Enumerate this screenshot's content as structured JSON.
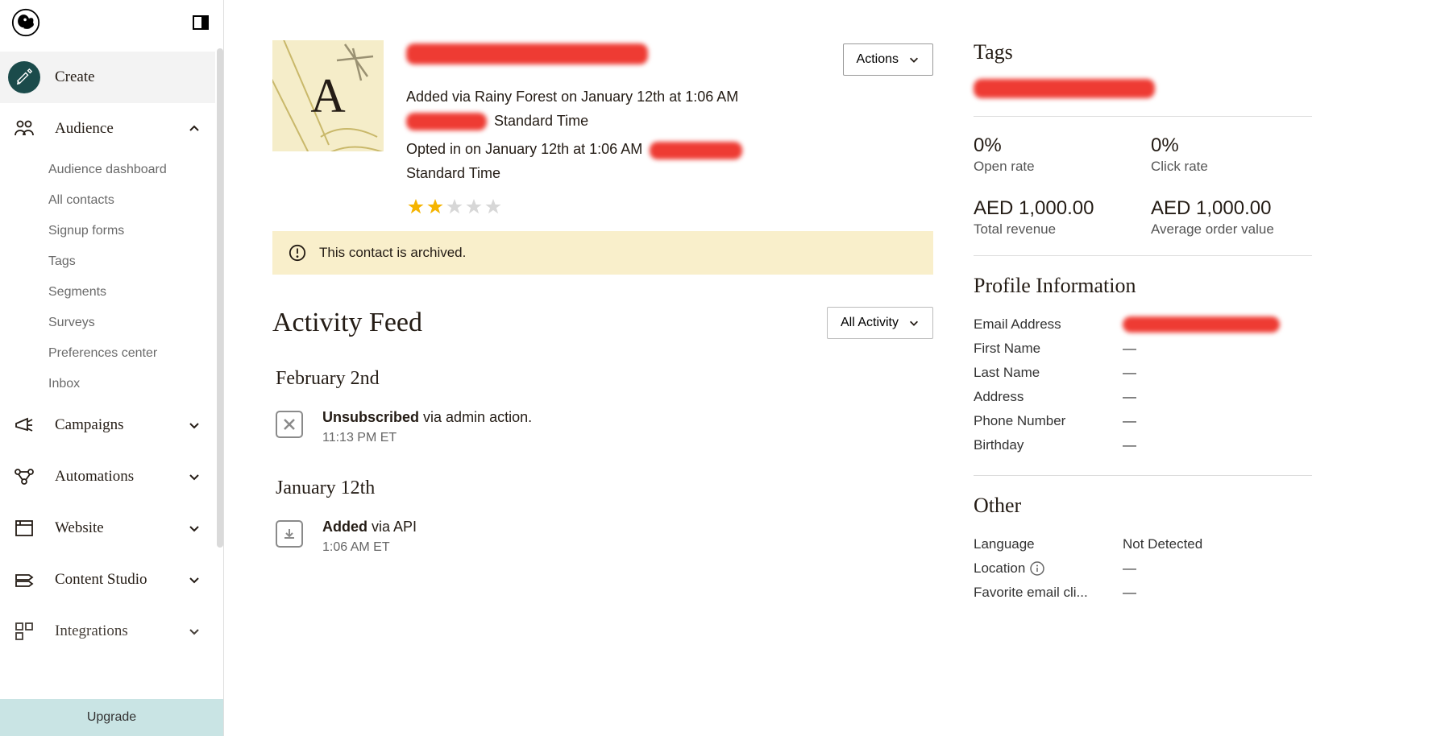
{
  "sidebar": {
    "create_label": "Create",
    "nav": [
      {
        "label": "Audience",
        "expanded": true,
        "sub": [
          "Audience dashboard",
          "All contacts",
          "Signup forms",
          "Tags",
          "Segments",
          "Surveys",
          "Preferences center",
          "Inbox"
        ]
      },
      {
        "label": "Campaigns",
        "expanded": false
      },
      {
        "label": "Automations",
        "expanded": false
      },
      {
        "label": "Website",
        "expanded": false
      },
      {
        "label": "Content Studio",
        "expanded": false
      },
      {
        "label": "Integrations",
        "expanded": false
      }
    ],
    "upgrade_label": "Upgrade"
  },
  "profile": {
    "avatar_letter": "A",
    "actions_label": "Actions",
    "added_prefix": "Added via Rainy Forest on January 12th at 1:06 AM",
    "added_suffix": "Standard Time",
    "opted_prefix": "Opted in on January 12th at 1:06 AM",
    "opted_suffix": "Standard Time",
    "rating": 2,
    "rating_max": 5,
    "archive_message": "This contact is archived."
  },
  "activity": {
    "heading": "Activity Feed",
    "filter_label": "All Activity",
    "groups": [
      {
        "date": "February 2nd",
        "items": [
          {
            "icon": "x",
            "title_bold": "Unsubscribed",
            "title_rest": " via admin action.",
            "time": "11:13 PM ET"
          }
        ]
      },
      {
        "date": "January 12th",
        "items": [
          {
            "icon": "download",
            "title_bold": "Added",
            "title_rest": " via API",
            "time": "1:06 AM ET"
          }
        ]
      }
    ]
  },
  "tags": {
    "heading": "Tags"
  },
  "stats": {
    "open_rate": {
      "value": "0%",
      "label": "Open rate"
    },
    "click_rate": {
      "value": "0%",
      "label": "Click rate"
    },
    "total_revenue": {
      "value": "AED 1,000.00",
      "label": "Total revenue"
    },
    "avg_order": {
      "value": "AED 1,000.00",
      "label": "Average order value"
    }
  },
  "profile_info": {
    "heading": "Profile Information",
    "rows": [
      {
        "label": "Email Address",
        "value": "[redacted]"
      },
      {
        "label": "First Name",
        "value": "—"
      },
      {
        "label": "Last Name",
        "value": "—"
      },
      {
        "label": "Address",
        "value": "—"
      },
      {
        "label": "Phone Number",
        "value": "—"
      },
      {
        "label": "Birthday",
        "value": "—"
      }
    ]
  },
  "other": {
    "heading": "Other",
    "rows": [
      {
        "label": "Language",
        "value": "Not Detected"
      },
      {
        "label": "Location",
        "value": "—",
        "has_info_icon": true
      },
      {
        "label": "Favorite email cli...",
        "value": "—"
      }
    ]
  }
}
